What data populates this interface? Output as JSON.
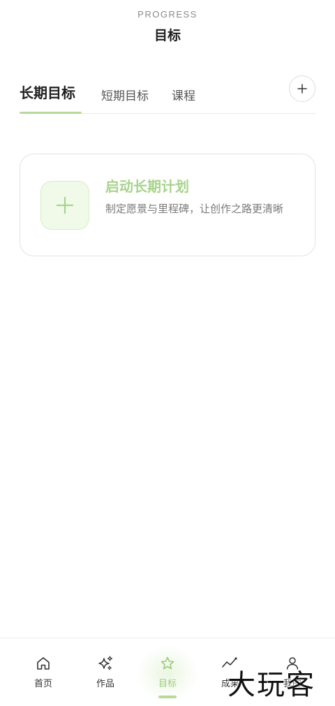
{
  "header": {
    "eyebrow": "PROGRESS",
    "title": "目标"
  },
  "tabs": {
    "items": [
      {
        "label": "长期目标",
        "active": true
      },
      {
        "label": "短期目标",
        "active": false
      },
      {
        "label": "课程",
        "active": false
      }
    ],
    "add_icon": "plus-icon"
  },
  "card": {
    "title": "启动长期计划",
    "description": "制定愿景与里程碑，让创作之路更清晰",
    "icon": "plus-icon"
  },
  "bottom_nav": {
    "items": [
      {
        "label": "首页",
        "icon": "home-icon",
        "active": false
      },
      {
        "label": "作品",
        "icon": "sparkle-icon",
        "active": false
      },
      {
        "label": "目标",
        "icon": "star-icon",
        "active": true
      },
      {
        "label": "成果",
        "icon": "trend-chart-icon",
        "active": false
      },
      {
        "label": "我的",
        "icon": "person-icon",
        "active": false
      }
    ]
  },
  "watermark": "大玩客",
  "colors": {
    "accent": "#a8d38c",
    "accent_light": "#f1f9e9",
    "text_primary": "#1f1f1f",
    "text_secondary": "#7a7a7a"
  }
}
